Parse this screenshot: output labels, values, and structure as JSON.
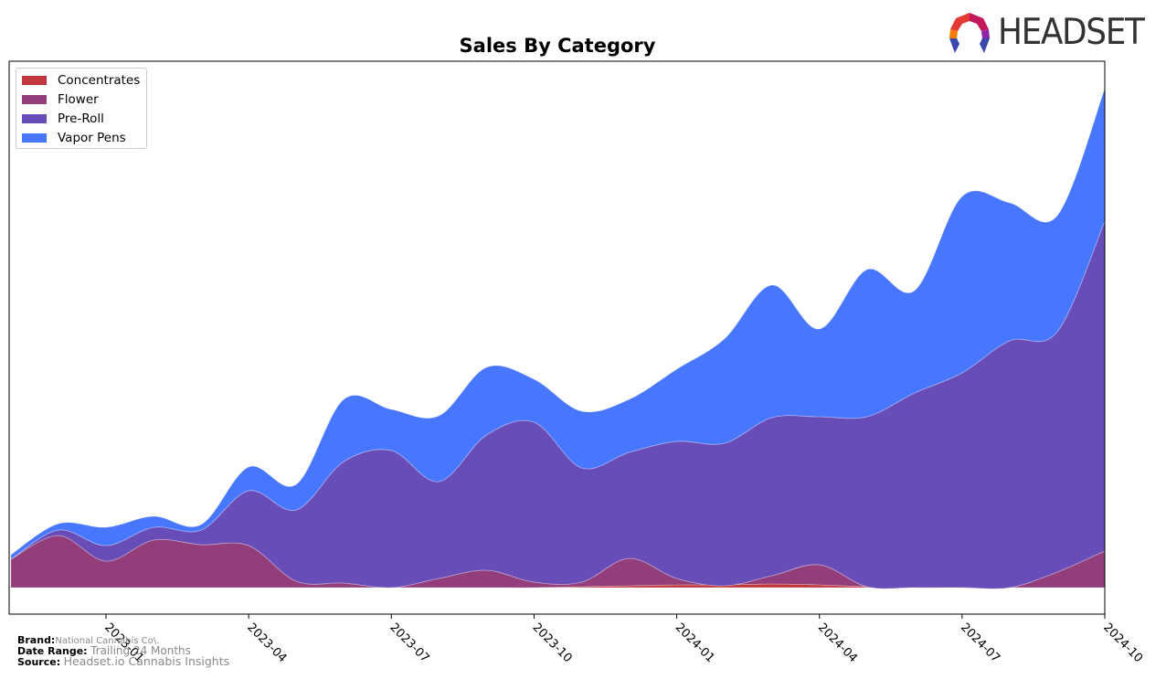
{
  "chart_data": {
    "type": "area",
    "stacked": true,
    "title": "Sales By Category",
    "xlabel": "",
    "ylabel": "",
    "y_ticks_shown": false,
    "x": [
      "2022-11",
      "2022-12",
      "2023-01",
      "2023-02",
      "2023-03",
      "2023-04",
      "2023-05",
      "2023-06",
      "2023-07",
      "2023-08",
      "2023-09",
      "2023-10",
      "2023-11",
      "2023-12",
      "2024-01",
      "2024-02",
      "2024-03",
      "2024-04",
      "2024-05",
      "2024-06",
      "2024-07",
      "2024-08",
      "2024-09",
      "2024-10"
    ],
    "x_tick_labels": [
      "2023-01",
      "2023-04",
      "2023-07",
      "2023-10",
      "2024-01",
      "2024-04",
      "2024-07",
      "2024-10"
    ],
    "ylim": [
      -29,
      576
    ],
    "legend_position": "top-left",
    "series": [
      {
        "name": "Concentrates",
        "color": "#c0363a",
        "values": [
          0,
          0,
          0,
          0,
          0,
          0,
          0,
          0,
          0,
          0,
          0,
          0,
          1,
          2,
          3,
          3,
          4,
          3,
          1,
          0,
          0,
          0,
          0,
          0
        ]
      },
      {
        "name": "Flower",
        "color": "#933e7a",
        "values": [
          31,
          57,
          29,
          52,
          47,
          46,
          7,
          5,
          0,
          10,
          19,
          6,
          5,
          30,
          7,
          -1,
          9,
          22,
          0,
          0,
          0,
          0,
          17,
          40
        ]
      },
      {
        "name": "Pre-Roll",
        "color": "#684db9",
        "values": [
          0,
          6,
          17,
          14,
          16,
          60,
          78,
          133,
          150,
          106,
          148,
          175,
          125,
          116,
          150,
          156,
          173,
          162,
          186,
          213,
          235,
          270,
          263,
          361
        ]
      },
      {
        "name": "Vapor Pens",
        "color": "#4877ff",
        "values": [
          5,
          7,
          20,
          12,
          6,
          26,
          28,
          68,
          45,
          72,
          74,
          47,
          62,
          58,
          79,
          114,
          145,
          96,
          161,
          112,
          193,
          151,
          127,
          145
        ]
      }
    ]
  },
  "legend": {
    "items": [
      {
        "label": "Concentrates",
        "color": "#c0363a"
      },
      {
        "label": "Flower",
        "color": "#933e7a"
      },
      {
        "label": "Pre-Roll",
        "color": "#684db9"
      },
      {
        "label": "Vapor Pens",
        "color": "#4877ff"
      }
    ]
  },
  "logo": {
    "text": "HEADSET"
  },
  "footer": {
    "brand_label": "Brand:",
    "brand_value": "National Cannabis Co\\.",
    "date_range_label": "Date Range:",
    "date_range_value": "Trailing 24 Months",
    "source_label": "Source:",
    "source_value": "Headset.io Cannabis Insights"
  }
}
